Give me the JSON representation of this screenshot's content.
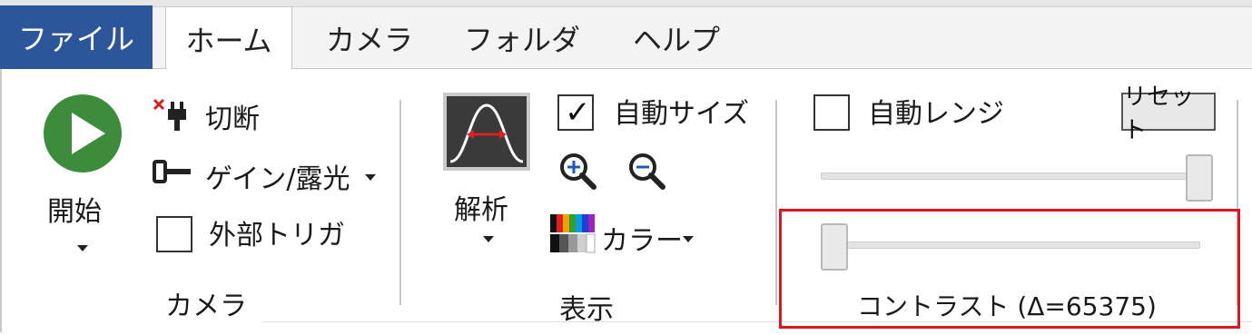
{
  "tabs": {
    "file": "ファイル",
    "home": "ホーム",
    "camera": "カメラ",
    "folder": "フォルダ",
    "help": "ヘルプ"
  },
  "camera_group": {
    "start_label": "開始",
    "disconnect_label": "切断",
    "gain_exposure_label": "ゲイン/露光",
    "external_trigger_label": "外部トリガ",
    "group_label": "カメラ"
  },
  "display_group": {
    "analysis_label": "解析",
    "auto_size_label": "自動サイズ",
    "auto_size_checked": true,
    "color_label": "カラー",
    "group_label": "表示"
  },
  "range_group": {
    "auto_range_label": "自動レンジ",
    "auto_range_checked": false,
    "reset_label": "リセット",
    "upper_slider_level": 1.0,
    "lower_slider_level": 0.0,
    "contrast_label": "コントラスト (Δ=65375)"
  },
  "colors": {
    "file_tab_bg": "#2b579a",
    "play_green": "#3c8c3c",
    "highlight_red": "#e0141e"
  }
}
